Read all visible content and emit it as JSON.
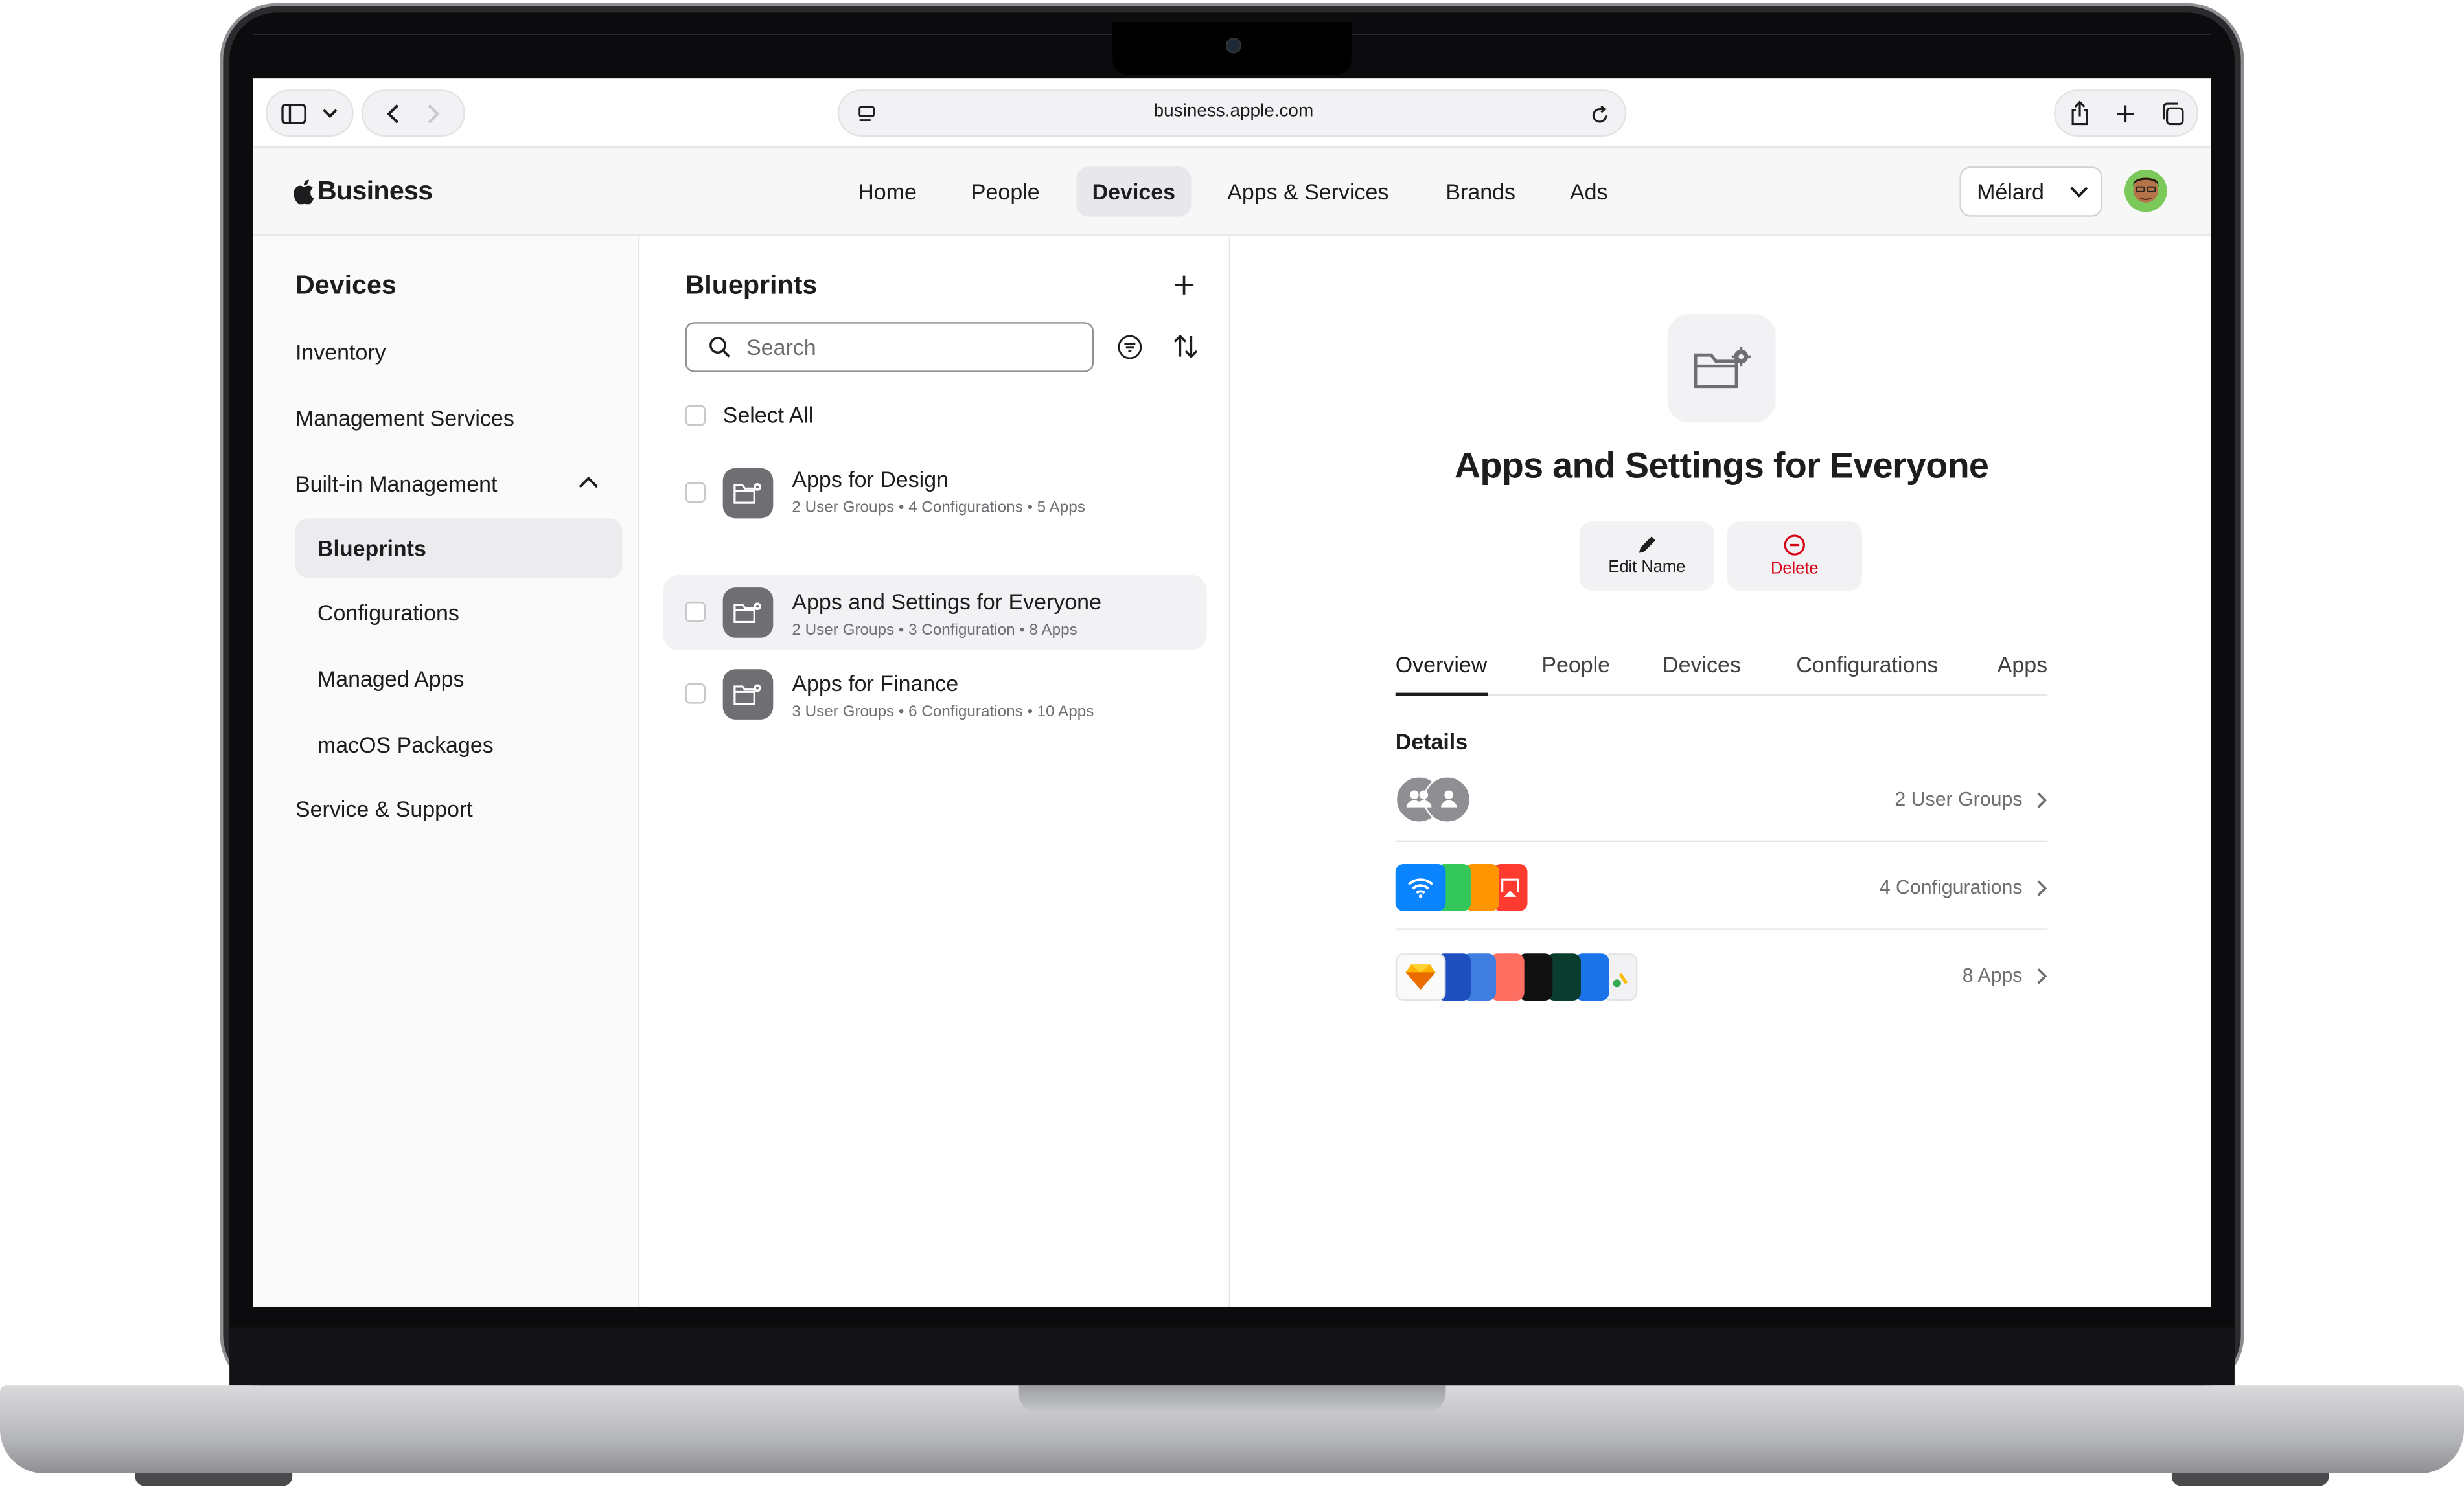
{
  "browser": {
    "url": "business.apple.com"
  },
  "app": {
    "logo_text": "Business",
    "nav": [
      "Home",
      "People",
      "Devices",
      "Apps & Services",
      "Brands",
      "Ads"
    ],
    "active_nav": "Devices",
    "org_selector": "Mélard"
  },
  "sidebar": {
    "title": "Devices",
    "items": [
      "Inventory",
      "Management Services",
      "Built-in Management",
      "Blueprints",
      "Configurations",
      "Managed Apps",
      "macOS Packages",
      "Service & Support"
    ],
    "active_item": "Blueprints"
  },
  "blueprints": {
    "title": "Blueprints",
    "search_placeholder": "Search",
    "select_all": "Select All",
    "rows": [
      {
        "title": "Apps for Design",
        "subtitle": "2 User Groups • 4 Configurations • 5 Apps"
      },
      {
        "title": "Apps and Settings for Everyone",
        "subtitle": "2 User Groups • 3 Configuration • 8 Apps"
      },
      {
        "title": "Apps for Finance",
        "subtitle": "3 User Groups • 6 Configurations • 10 Apps"
      }
    ],
    "selected_index": 1
  },
  "detail": {
    "title": "Apps and Settings for Everyone",
    "edit_label": "Edit Name",
    "delete_label": "Delete",
    "tabs": [
      "Overview",
      "People",
      "Devices",
      "Configurations",
      "Apps"
    ],
    "active_tab": "Overview",
    "section_label": "Details",
    "rows": [
      {
        "value": "2 User Groups",
        "icon": "user-groups-icon"
      },
      {
        "value": "4 Configurations",
        "icon": "configurations-icon"
      },
      {
        "value": "8 Apps",
        "icon": "apps-icon"
      }
    ]
  },
  "colors": {
    "accent_delete": "#d70015",
    "blueprint_icon": "#6e6e73",
    "wifi_tile": "#0a84ff"
  }
}
